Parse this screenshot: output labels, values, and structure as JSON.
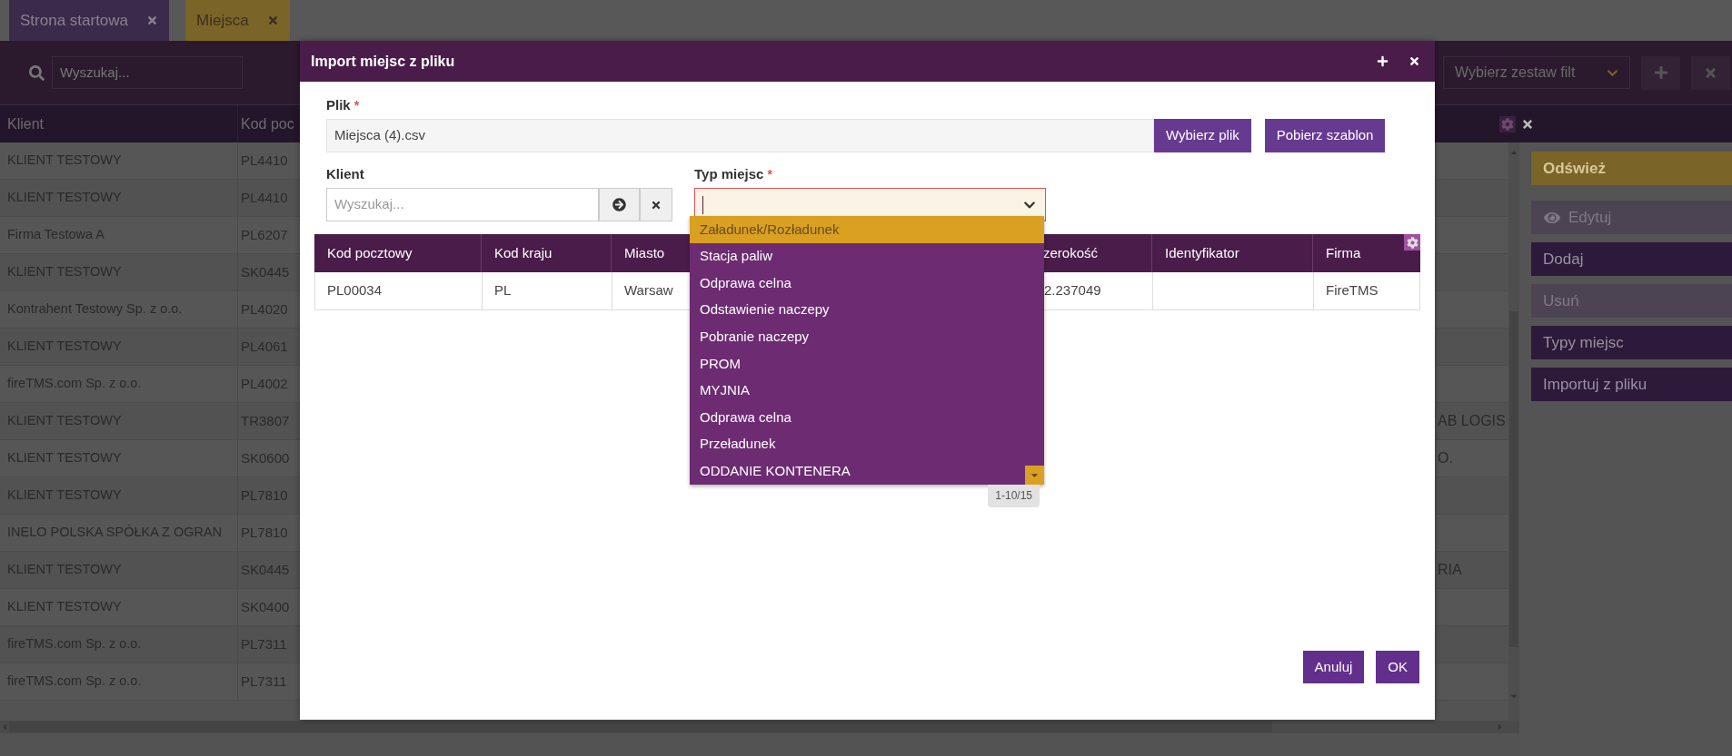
{
  "tabs": [
    {
      "label": "Strona startowa",
      "selected": false
    },
    {
      "label": "Miejsca",
      "selected": true
    }
  ],
  "toolbar": {
    "search_placeholder": "Wyszukaj...",
    "filter_set": "Wybierz zestaw filt"
  },
  "table": {
    "columns": [
      "Klient",
      "Kod poc"
    ],
    "rows": [
      {
        "client": "KLIENT TESTOWY",
        "postal_code": "PL4410"
      },
      {
        "client": "KLIENT TESTOWY",
        "postal_code": "PL4410"
      },
      {
        "client": "Firma Testowa A",
        "postal_code": "PL6207"
      },
      {
        "client": "KLIENT TESTOWY",
        "postal_code": "SK0445"
      },
      {
        "client": "Kontrahent Testowy Sp. z o.o.",
        "postal_code": "PL4020"
      },
      {
        "client": "KLIENT TESTOWY",
        "postal_code": "PL4061"
      },
      {
        "client": "fireTMS.com Sp. z o.o.",
        "postal_code": "PL4002"
      },
      {
        "client": "KLIENT TESTOWY",
        "postal_code": "TR3807",
        "column_3": "AB LOGIS"
      },
      {
        "client": "KLIENT TESTOWY",
        "postal_code": "SK0600",
        "column_3": "O."
      },
      {
        "client": "KLIENT TESTOWY",
        "postal_code": "PL7810"
      },
      {
        "client": "INELO POLSKA SPÓŁKA Z OGRAN",
        "postal_code": "PL7810"
      },
      {
        "client": "KLIENT TESTOWY",
        "postal_code": "SK0445",
        "column_3": "RIA"
      },
      {
        "client": "KLIENT TESTOWY",
        "postal_code": "SK0400"
      },
      {
        "client": "fireTMS.com Sp. z o.o.",
        "postal_code": "PL7311"
      },
      {
        "client": "fireTMS.com Sp. z o.o.",
        "postal_code": "PL7311"
      }
    ]
  },
  "side_buttons": [
    {
      "label": "Odśwież",
      "kind": "accent",
      "disabled": false
    },
    {
      "label": "Edytuj",
      "kind": "view",
      "disabled": true
    },
    {
      "label": "Dodaj",
      "kind": "plain",
      "disabled": false
    },
    {
      "label": "Usuń",
      "kind": "plain",
      "disabled": true
    },
    {
      "label": "Typy miejsc",
      "kind": "plain",
      "disabled": false
    },
    {
      "label": "Importuj z pliku",
      "kind": "plain",
      "disabled": false
    }
  ],
  "dialog": {
    "title": "Import miejsc z pliku",
    "file": {
      "label": "Plik",
      "required_mark": "*",
      "value": "Miejsca (4).csv",
      "choose_button": "Wybierz plik",
      "template_button": "Pobierz szablon"
    },
    "client": {
      "label": "Klient",
      "placeholder": "Wyszukaj..."
    },
    "place_type": {
      "label": "Typ miejsc",
      "required_mark": "*",
      "invalid": true
    },
    "table": {
      "columns": [
        "Kod pocztowy",
        "Kod kraju",
        "Miasto",
        "zerokość",
        "Identyfikator",
        "Firma"
      ],
      "rows": [
        [
          "PL00034",
          "PL",
          "Warsaw",
          "2.237049",
          null,
          "FireTMS"
        ]
      ]
    },
    "dropdown": {
      "options": [
        {
          "label": "Załadunek/Rozładunek",
          "selected": true
        },
        {
          "label": "Stacja paliw",
          "selected": false
        },
        {
          "label": "Odprawa celna",
          "selected": false
        },
        {
          "label": "Odstawienie naczepy",
          "selected": false
        },
        {
          "label": "Pobranie naczepy",
          "selected": false
        },
        {
          "label": "PROM",
          "selected": false
        },
        {
          "label": "MYJNIA",
          "selected": false
        },
        {
          "label": "Odprawa celna",
          "selected": false
        },
        {
          "label": "Przeładunek",
          "selected": false
        },
        {
          "label": "ODDANIE KONTENERA",
          "selected": false
        }
      ],
      "pager": "1-10/15"
    },
    "footer_buttons": [
      "Anuluj",
      "OK"
    ]
  }
}
